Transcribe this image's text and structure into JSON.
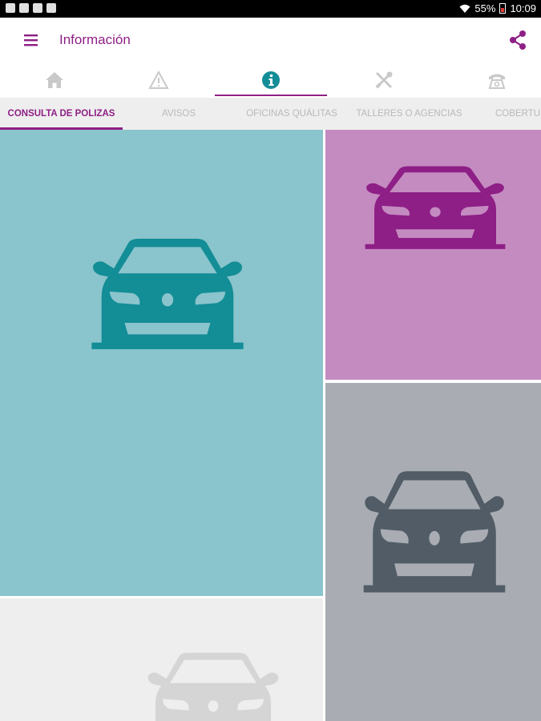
{
  "status_bar": {
    "battery": "55%",
    "time": "10:09"
  },
  "app_bar": {
    "title": "Información",
    "menu_icon": "hamburger-menu-icon",
    "share_icon": "share-icon"
  },
  "icon_tabs": [
    {
      "icon": "home-icon",
      "selected": false
    },
    {
      "icon": "warning-icon",
      "selected": false
    },
    {
      "icon": "info-icon",
      "selected": true
    },
    {
      "icon": "tools-icon",
      "selected": false
    },
    {
      "icon": "phone-icon",
      "selected": false
    }
  ],
  "text_tabs": [
    {
      "label": "CONSULTA DE POLIZAS",
      "selected": true
    },
    {
      "label": "AVISOS",
      "selected": false
    },
    {
      "label": "OFICINAS QUÁLITAS",
      "selected": false
    },
    {
      "label": "TALLERES O AGENCIAS",
      "selected": false
    },
    {
      "label": "COBERTU",
      "selected": false
    }
  ],
  "tiles": [
    {
      "icon": "car-icon",
      "background": "#8ac4cc",
      "icon_color": "#138d96"
    },
    {
      "icon": "car-icon",
      "background": "#c48bc0",
      "icon_color": "#8e1f86"
    },
    {
      "icon": "car-icon",
      "background": "#a9adb3",
      "icon_color": "#515c66"
    },
    {
      "icon": "car-icon",
      "background": "#eeeeee",
      "icon_color": "#d5d5d5"
    }
  ],
  "colors": {
    "brand": "#8e1f86",
    "teal": "#138d96",
    "inactive": "#c9c9c9"
  }
}
